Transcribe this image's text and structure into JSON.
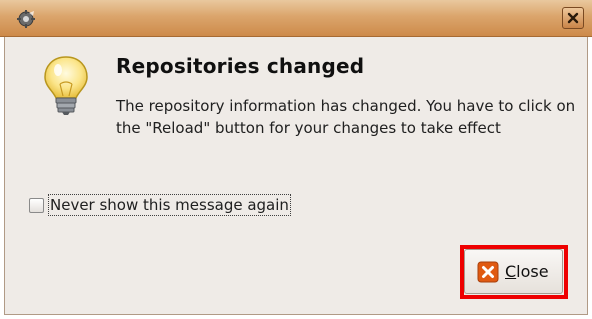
{
  "window": {
    "app_icon": "gear-icon",
    "close_icon": "close-icon"
  },
  "dialog": {
    "icon": "lightbulb-icon",
    "heading": "Repositories changed",
    "message": "The repository information has changed. You have to click on the \"Reload\" button for your changes to take effect"
  },
  "checkbox": {
    "label": "Never show this message again",
    "checked": false
  },
  "close_button": {
    "icon": "close-button-icon",
    "label_mnemonic": "C",
    "label_rest": "lose",
    "accent": "#e05a12"
  },
  "highlight": {
    "color": "#ee0000"
  }
}
